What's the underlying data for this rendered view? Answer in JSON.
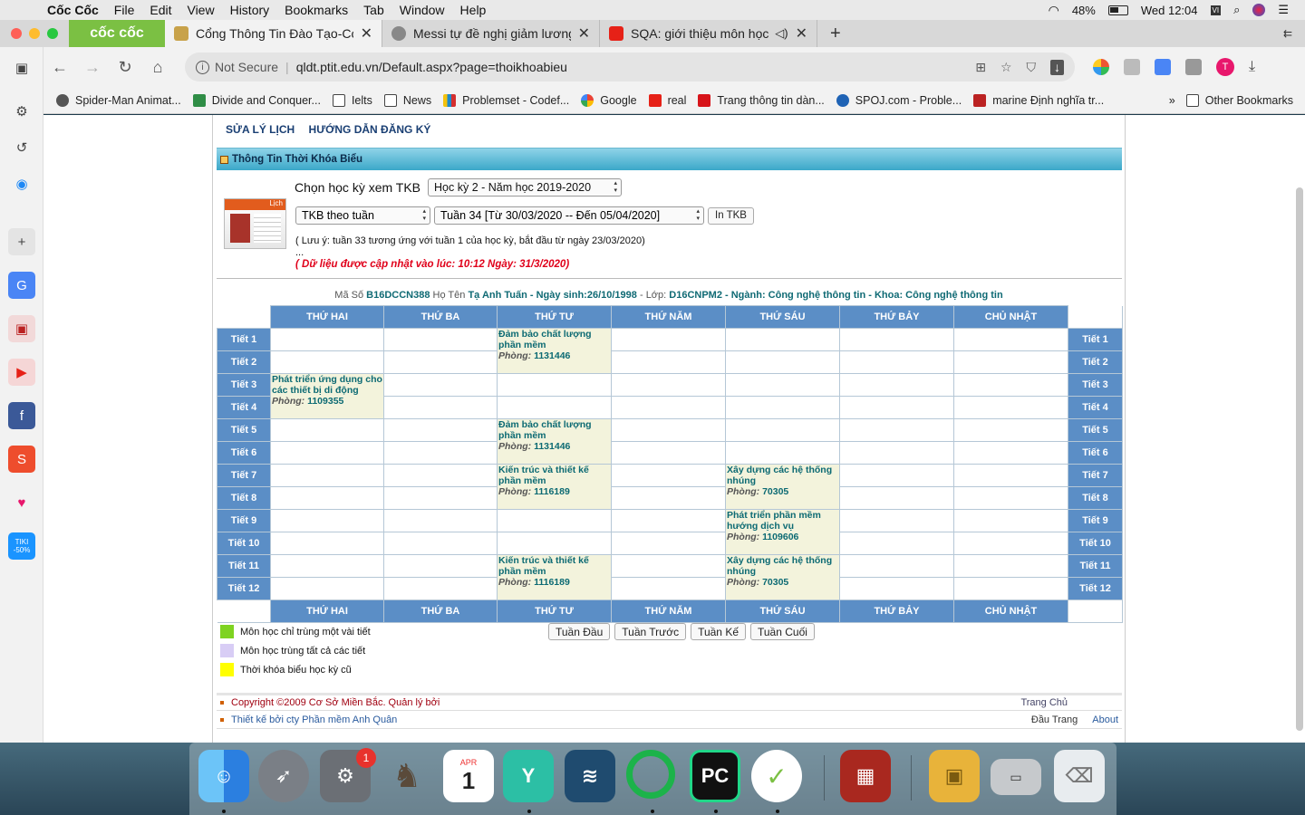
{
  "menubar": {
    "app": "Cốc Cốc",
    "items": [
      "File",
      "Edit",
      "View",
      "History",
      "Bookmarks",
      "Tab",
      "Window",
      "Help"
    ],
    "battery": "48%",
    "clock": "Wed 12:04"
  },
  "browser": {
    "brand": "cốc cốc",
    "tabs": [
      {
        "title": "Cổng Thông Tin Đào Tạo-Cơ"
      },
      {
        "title": "Messi tự đề nghị giảm lương"
      },
      {
        "title": "SQA: giới thiệu môn học -"
      }
    ],
    "url": {
      "security": "Not Secure",
      "address": "qldt.ptit.edu.vn/Default.aspx?page=thoikhoabieu"
    },
    "profile_initial": "T",
    "bookmarks": [
      "Spider-Man Animat...",
      "Divide and Conquer...",
      "Ielts",
      "News",
      "Problemset - Codef...",
      "Google",
      "real",
      "Trang thông tin dàn...",
      "SPOJ.com - Proble...",
      "marine Định nghĩa tr..."
    ],
    "other_bookmarks": "Other Bookmarks"
  },
  "page": {
    "topnav": [
      "SỬA LÝ LỊCH",
      "HƯỚNG DẪN ĐĂNG KÝ"
    ],
    "panel_title": "Thông Tin Thời Khóa Biểu",
    "calendar_label": "Lịch",
    "semester_label": "Chọn học kỳ xem TKB",
    "semester_value": "Học kỳ 2 - Năm học 2019-2020",
    "view_mode": "TKB theo tuần",
    "week_value": "Tuần 34 [Từ 30/03/2020 -- Đến 05/04/2020]",
    "print_button": "In TKB",
    "note": "( Lưu ý: tuần 33 tương ứng với tuần 1 của học kỳ, bắt đầu từ ngày 23/03/2020)",
    "note_dots": "...",
    "updated": "( Dữ liệu được cập nhật vào lúc: 10:12 Ngày: 31/3/2020)",
    "student": {
      "id_label": "Mã Số",
      "id": "B16DCCN388",
      "name_label": "Họ Tên",
      "name": "Tạ Anh Tuấn - Ngày sinh:26/10/1998",
      "class_label": "- Lớp:",
      "class": "D16CNPM2 - Ngành: Công nghệ thông tin - Khoa: Công nghệ thông tin"
    },
    "days": [
      "THỨ HAI",
      "THỨ BA",
      "THỨ TƯ",
      "THỨ NĂM",
      "THỨ SÁU",
      "THỨ BẢY",
      "CHỦ NHẬT"
    ],
    "periods": [
      "Tiết 1",
      "Tiết 2",
      "Tiết 3",
      "Tiết 4",
      "Tiết 5",
      "Tiết 6",
      "Tiết 7",
      "Tiết 8",
      "Tiết 9",
      "Tiết 10",
      "Tiết 11",
      "Tiết 12"
    ],
    "room_label": "Phòng:",
    "classes": [
      {
        "day": 2,
        "start": 0,
        "span": 2,
        "subject": "Đảm bảo chất lượng phần mềm",
        "room": "1131446"
      },
      {
        "day": 0,
        "start": 2,
        "span": 2,
        "subject": "Phát triển ứng dụng cho các thiết bị di động",
        "room": "1109355"
      },
      {
        "day": 2,
        "start": 4,
        "span": 2,
        "subject": "Đảm bảo chất lượng phần mềm",
        "room": "1131446"
      },
      {
        "day": 2,
        "start": 6,
        "span": 2,
        "subject": "Kiến trúc và thiết kế phần mềm",
        "room": "1116189"
      },
      {
        "day": 4,
        "start": 6,
        "span": 2,
        "subject": "Xây dựng các hệ thống nhúng",
        "room": "70305"
      },
      {
        "day": 4,
        "start": 8,
        "span": 2,
        "subject": "Phát triển phần mềm hướng dịch vụ",
        "room": "1109606"
      },
      {
        "day": 2,
        "start": 10,
        "span": 2,
        "subject": "Kiến trúc và thiết kế phần mềm",
        "room": "1116189"
      },
      {
        "day": 4,
        "start": 10,
        "span": 2,
        "subject": "Xây dựng các hệ thống nhúng",
        "room": "70305"
      }
    ],
    "legend": [
      {
        "label": "Môn học chỉ trùng một vài tiết",
        "color": "#7ed321"
      },
      {
        "label": "Môn học trùng tất cả các tiết",
        "color": "#d8cdf5"
      },
      {
        "label": "Thời khóa biểu học kỳ cũ",
        "color": "#ffff00"
      }
    ],
    "week_nav": [
      "Tuần Đầu",
      "Tuần Trước",
      "Tuần Kế",
      "Tuần Cuối"
    ],
    "footer": {
      "copyright": "Copyright ©2009 Cơ Sở Miền Bắc. Quản lý bởi",
      "designer": "Thiết kế bởi cty Phần mềm Anh Quân",
      "home": "Trang Chủ",
      "top": "Đầu Trang",
      "about": "About"
    }
  },
  "dock": {
    "calendar_month": "APR",
    "calendar_day": "1",
    "notification_count": "1"
  },
  "sidebar_promo": "TIKI -50%",
  "colors": {
    "header_blue": "#5b8ec6",
    "cell_bg": "#f3f3dc",
    "subject_text": "#0c6a73",
    "brand_green": "#7bc043"
  }
}
